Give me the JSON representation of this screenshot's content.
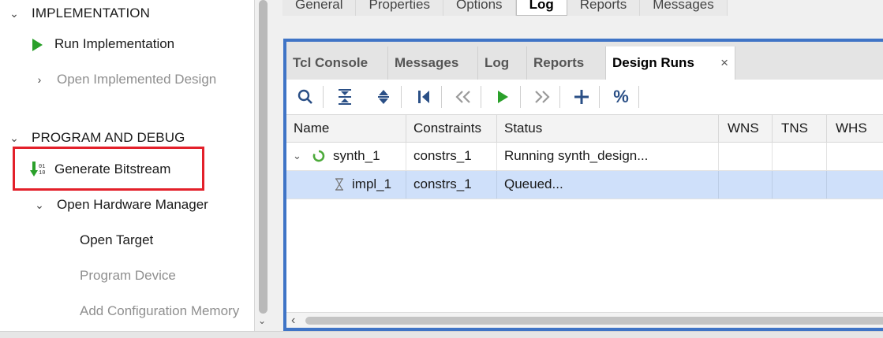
{
  "flow_navigator": {
    "implementation": {
      "section_label": "IMPLEMENTATION",
      "run_label": "Run Implementation",
      "open_design_label": "Open Implemented Design"
    },
    "program_debug": {
      "section_label": "PROGRAM AND DEBUG",
      "generate_bitstream_label": "Generate Bitstream",
      "bitstream_icon_text": "01\n10",
      "hardware_manager_label": "Open Hardware Manager",
      "open_target_label": "Open Target",
      "program_device_label": "Program Device",
      "add_config_memory_label": "Add Configuration Memory"
    }
  },
  "properties_tabs": [
    "General",
    "Properties",
    "Options",
    "Log",
    "Reports",
    "Messages"
  ],
  "properties_active_tab": "Log",
  "bottom_panel": {
    "tabs": [
      "Tcl Console",
      "Messages",
      "Log",
      "Reports",
      "Design Runs"
    ],
    "active_tab": "Design Runs",
    "close_glyph": "×",
    "toolbar_icons": [
      "search-icon",
      "collapse-all-icon",
      "expand-all-icon",
      "first-icon",
      "previous-icon",
      "launch-icon",
      "next-icon",
      "add-icon",
      "percent-icon"
    ],
    "toolbar_percent_glyph": "%",
    "columns": [
      "Name",
      "Constraints",
      "Status",
      "WNS",
      "TNS",
      "WHS"
    ],
    "rows": [
      {
        "name": "synth_1",
        "constraints": "constrs_1",
        "status": "Running synth_design...",
        "wns": "",
        "tns": "",
        "whs": ""
      },
      {
        "name": "impl_1",
        "constraints": "constrs_1",
        "status": "Queued...",
        "wns": "",
        "tns": "",
        "whs": ""
      }
    ],
    "selected_row": "impl_1"
  },
  "colors": {
    "accent_blue": "#3f74c6",
    "run_green": "#2aa02a",
    "highlight_red": "#e3202a",
    "selection_blue": "#cfe0fa"
  }
}
